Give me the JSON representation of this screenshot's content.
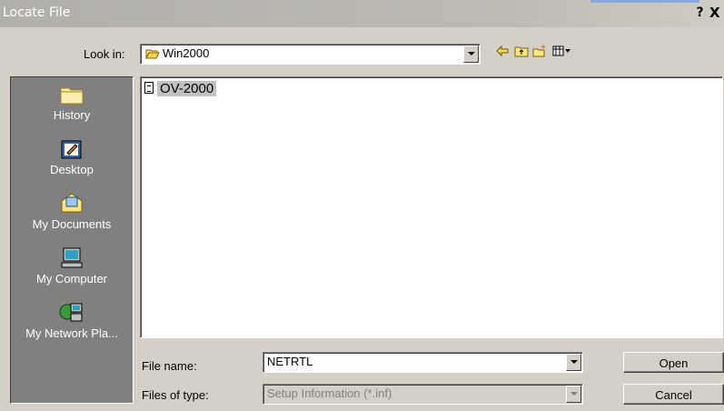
{
  "window": {
    "title": "Locate File",
    "help_label": "?",
    "close_label": "X"
  },
  "lookin": {
    "label": "Look in:",
    "value": "Win2000",
    "toolbar_icons": [
      "back-arrow-icon",
      "up-folder-icon",
      "new-folder-icon",
      "view-menu-icon"
    ]
  },
  "places": [
    {
      "label": "History",
      "icon": "history-folder-icon"
    },
    {
      "label": "Desktop",
      "icon": "desktop-icon"
    },
    {
      "label": "My Documents",
      "icon": "my-documents-icon"
    },
    {
      "label": "My Computer",
      "icon": "my-computer-icon"
    },
    {
      "label": "My Network Pla...",
      "icon": "network-places-icon"
    }
  ],
  "files": [
    {
      "name": "OV-2000",
      "icon": "setup-file-icon",
      "selected": true
    }
  ],
  "filename": {
    "label": "File name:",
    "value": "NETRTL"
  },
  "filetype": {
    "label": "Files of type:",
    "value": "Setup Information (*.inf)"
  },
  "buttons": {
    "open": "Open",
    "cancel": "Cancel"
  },
  "colors": {
    "places_bg": "#808080",
    "dialog_bg": "#d4d0c8",
    "selection": "#c0c0c0"
  }
}
